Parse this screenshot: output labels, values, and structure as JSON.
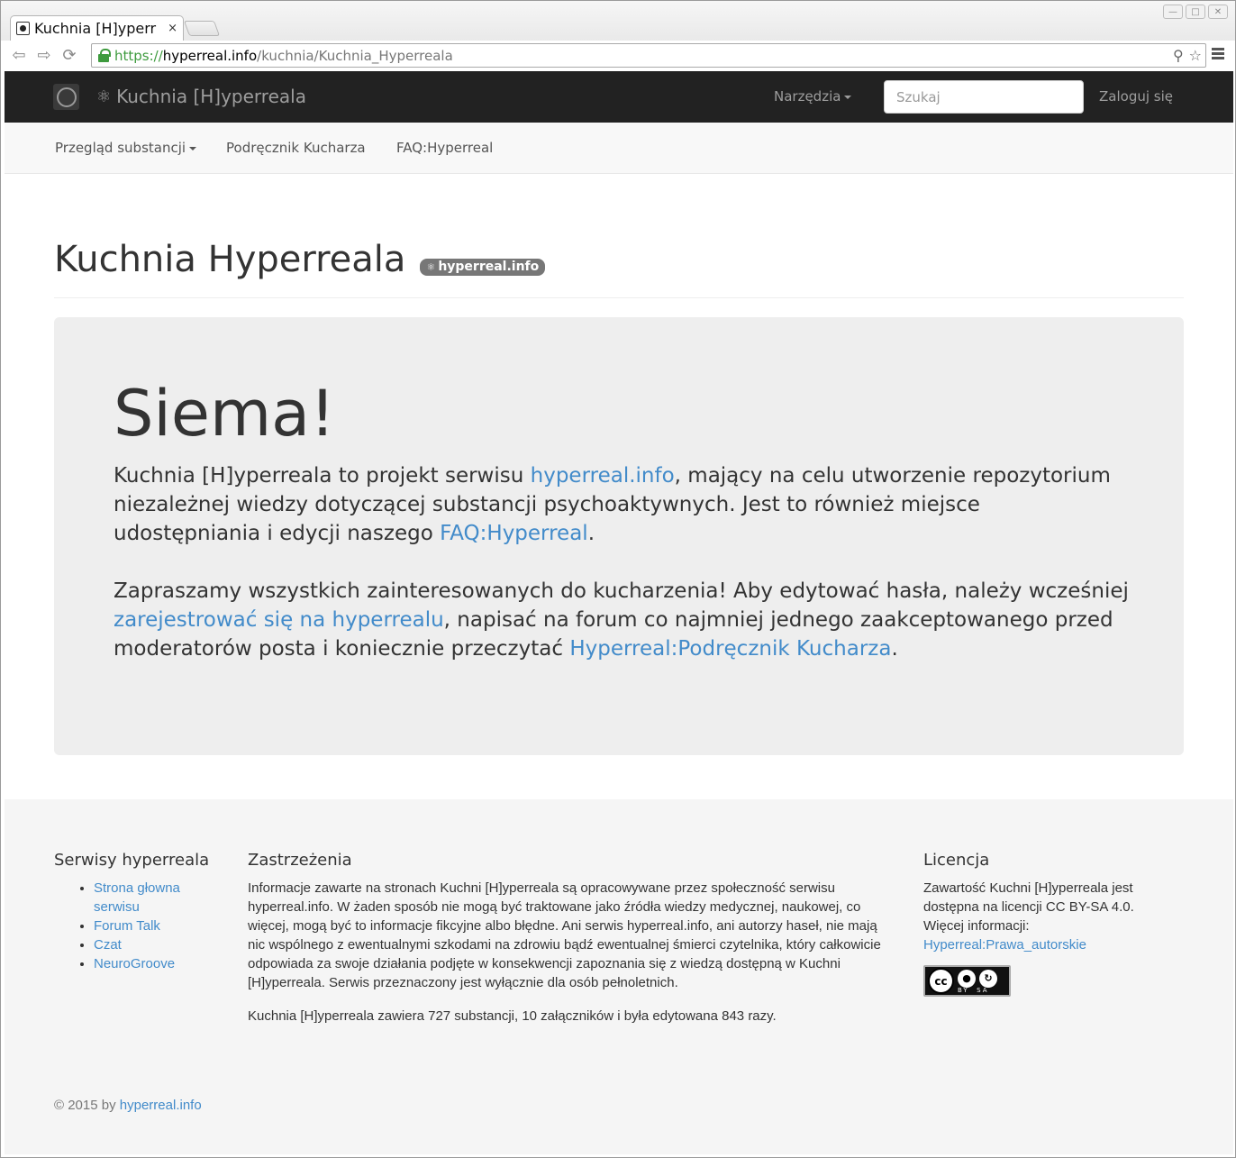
{
  "browser": {
    "tab_title": "Kuchnia [H]yperr",
    "tab_close": "×",
    "url_scheme": "https://",
    "url_host": "hyperreal.info",
    "url_path": "/kuchnia/Kuchnia_Hyperreala"
  },
  "topnav": {
    "brand": "Kuchnia [H]yperreala",
    "tools": "Narzędzia",
    "search_placeholder": "Szukaj",
    "login": "Zaloguj się"
  },
  "subnav": {
    "items": [
      {
        "label": "Przegląd substancji"
      },
      {
        "label": "Podręcznik Kucharza"
      },
      {
        "label": "FAQ:Hyperreal"
      }
    ]
  },
  "header": {
    "title": "Kuchnia Hyperreala",
    "badge": "hyperreal.info"
  },
  "jumbotron": {
    "title": "Siema!",
    "p1_a": "Kuchnia [H]yperreala to projekt serwisu ",
    "p1_link": "hyperreal.info",
    "p1_b": ", mający na celu utworzenie repozytorium niezależnej wiedzy dotyczącej substancji psychoaktywnych. Jest to również miejsce udostępniania i edycji naszego ",
    "p1_link2": "FAQ:Hyperreal",
    "p1_c": ".",
    "p2_a": "Zapraszamy wszystkich zainteresowanych do kucharzenia! Aby edytować hasła, należy wcześniej ",
    "p2_link": "zarejestrować się na hyperrealu",
    "p2_b": ", napisać na forum co najmniej jednego zaakceptowanego przed moderatorów posta i koniecznie przeczytać ",
    "p2_link2": "Hyperreal:Podręcznik Kucharza",
    "p2_c": "."
  },
  "footer": {
    "services_title": "Serwisy hyperreala",
    "services": [
      "Strona głowna serwisu",
      "Forum Talk",
      "Czat",
      "NeuroGroove"
    ],
    "disclaimer_title": "Zastrzeżenia",
    "disclaimer": "Informacje zawarte na stronach Kuchni [H]yperreala są opracowywane przez społeczność serwisu hyperreal.info. W żaden sposób nie mogą być traktowane jako źródła wiedzy medycznej, naukowej, co więcej, mogą być to informacje fikcyjne albo błędne. Ani serwis hyperreal.info, ani autorzy haseł, nie mają nic wspólnego z ewentualnymi szkodami na zdrowiu bądź ewentualnej śmierci czytelnika, który całkowicie odpowiada za swoje działania podjęte w konsekwencji zapoznania się z wiedzą dostępną w Kuchni [H]yperreala. Serwis przeznaczony jest wyłącznie dla osób pełnoletnich.",
    "stats": "Kuchnia [H]yperreala zawiera 727 substancji, 10 załączników i była edytowana 843 razy.",
    "license_title": "Licencja",
    "license_text": "Zawartość Kuchni [H]yperreala jest dostępna na licencji CC BY-SA 4.0. Więcej informacji:",
    "license_link": "Hyperreal:Prawa_autorskie",
    "cc_main": "cc",
    "cc_by": "BY",
    "cc_sa": "SA",
    "copyright_prefix": "© 2015 by ",
    "copyright_link": "hyperreal.info"
  }
}
